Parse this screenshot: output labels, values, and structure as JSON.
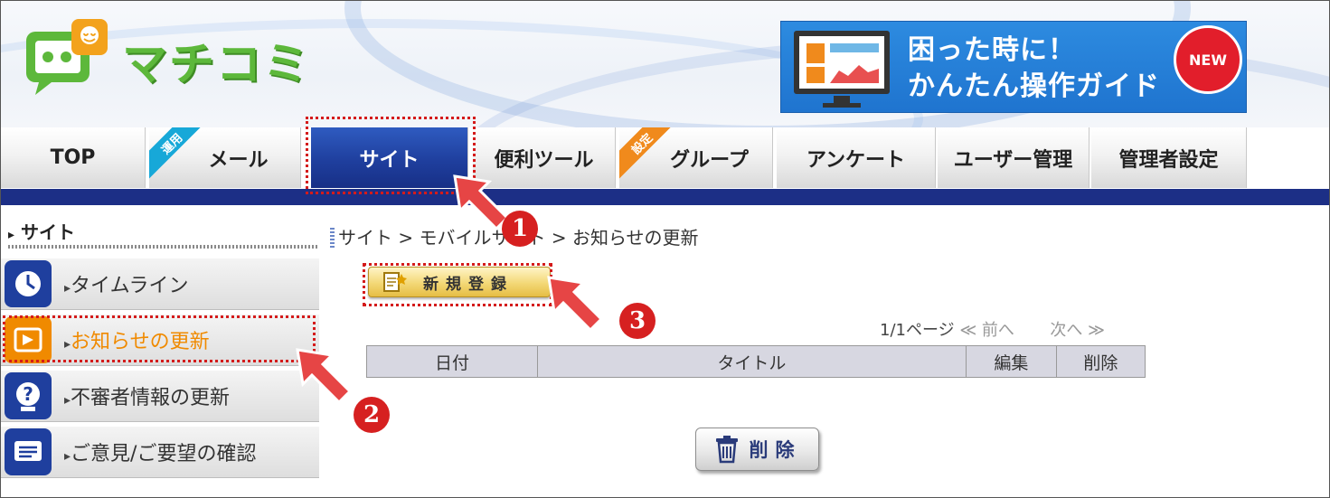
{
  "header": {
    "logo_text": "マチコミ",
    "banner_line1": "困った時に！",
    "banner_line2": "かんたん操作ガイド",
    "banner_badge": "NEW"
  },
  "nav": {
    "tabs": [
      {
        "label": "TOP"
      },
      {
        "label": "メール",
        "corner": "運用"
      },
      {
        "label": "サイト",
        "active": true
      },
      {
        "label": "便利ツール"
      },
      {
        "label": "グループ",
        "corner": "設定"
      },
      {
        "label": "アンケート"
      },
      {
        "label": "ユーザー管理"
      },
      {
        "label": "管理者設定"
      }
    ]
  },
  "sidebar": {
    "title": "サイト",
    "items": [
      {
        "label": "タイムライン",
        "icon": "clock-icon"
      },
      {
        "label": "お知らせの更新",
        "icon": "announcement-icon",
        "active": true
      },
      {
        "label": "不審者情報の更新",
        "icon": "question-person-icon"
      },
      {
        "label": "ご意見/ご要望の確認",
        "icon": "message-icon"
      }
    ]
  },
  "main": {
    "breadcrumb": "サイト > モバイルサイト > お知らせの更新",
    "new_button": "新規登録",
    "pager": {
      "page": "1/1ページ",
      "prev": "前へ",
      "next": "次へ"
    },
    "table_headers": [
      "日付",
      "タイトル",
      "編集",
      "削除"
    ],
    "delete_button": "削除"
  },
  "annotations": {
    "step1": "1",
    "step2": "2",
    "step3": "3"
  },
  "colors": {
    "nav_active": "#1f3f9e",
    "nav_strip": "#1c2f86",
    "annotation_red": "#d62020",
    "sidebar_active": "#f08a00",
    "banner_blue": "#2d8be0",
    "corner_teal": "#17a8d8",
    "corner_orange": "#f08a1c"
  }
}
